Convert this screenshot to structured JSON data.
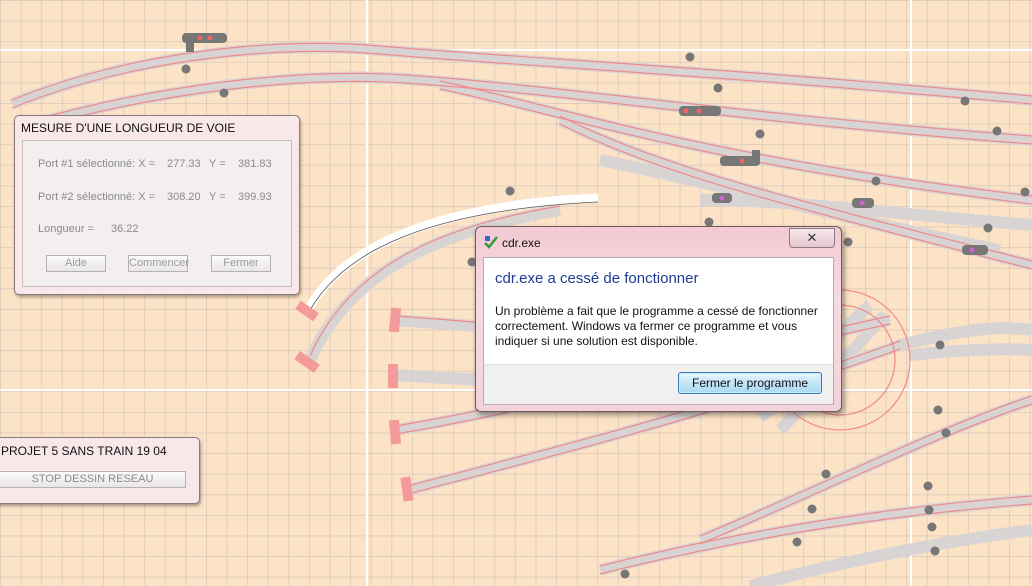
{
  "measure_window": {
    "title": "MESURE D'UNE LONGUEUR DE VOIE",
    "port1_label": "Port #1 sélectionné: X =",
    "port1_x": "277.33",
    "port1_y_label": "Y =",
    "port1_y": "381.83",
    "port2_label": "Port #2 sélectionné: X =",
    "port2_x": "308.20",
    "port2_y_label": "Y =",
    "port2_y": "399.93",
    "length_label": "Longueur =",
    "length_value": "36.22",
    "help_button": "Aide",
    "start_button": "Commencer",
    "close_button": "Fermer"
  },
  "project_window": {
    "title": "PROJET 5  SANS TRAIN 19 04",
    "stop_button": "STOP DESSIN RESEAU"
  },
  "error_dialog": {
    "title": "cdr.exe",
    "close_glyph": "✕",
    "heading": "cdr.exe a cessé de fonctionner",
    "message": "Un problème a fait que le programme a cessé de fonctionner correctement. Windows va fermer ce programme et vous indiquer si une solution est disponible.",
    "button": "Fermer le programme"
  },
  "colors": {
    "background": "#fde3c6",
    "track_fill": "#d9d4d4",
    "rail": "#f08a8a",
    "buffer": "#f59a9a",
    "dialog_heading": "#1e3c96"
  },
  "icons": [
    "signal-icon",
    "track-marker-icon",
    "app-icon",
    "close-icon"
  ]
}
